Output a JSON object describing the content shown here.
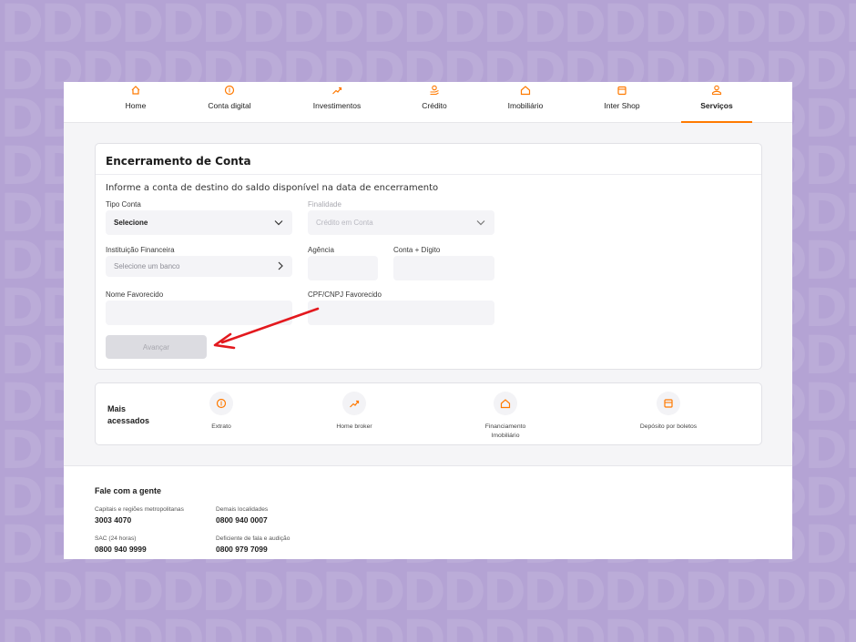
{
  "nav": [
    {
      "label": "Home",
      "icon": "home-icon"
    },
    {
      "label": "Conta digital",
      "icon": "coin-icon"
    },
    {
      "label": "Investimentos",
      "icon": "chart-up-icon"
    },
    {
      "label": "Crédito",
      "icon": "hand-coin-icon"
    },
    {
      "label": "Imobiliário",
      "icon": "house-icon"
    },
    {
      "label": "Inter Shop",
      "icon": "shop-icon"
    },
    {
      "label": "Serviços",
      "icon": "services-icon",
      "active": true
    }
  ],
  "form": {
    "title": "Encerramento de Conta",
    "subtitle": "Informe a conta de destino do saldo disponível na data de encerramento",
    "tipo_conta_label": "Tipo Conta",
    "tipo_conta_value": "Selecione",
    "finalidade_label": "Finalidade",
    "finalidade_value": "Crédito em Conta",
    "instituicao_label": "Instituição Financeira",
    "instituicao_placeholder": "Selecione um banco",
    "agencia_label": "Agência",
    "conta_label": "Conta + Dígito",
    "nome_label": "Nome Favorecido",
    "cpf_label": "CPF/CNPJ Favorecido",
    "avancar_label": "Avançar"
  },
  "mais_acessados": {
    "title_line1": "Mais",
    "title_line2": "acessados",
    "items": [
      {
        "line1": "Extrato",
        "line2": "",
        "icon": "coin-icon"
      },
      {
        "line1": "Home broker",
        "line2": "",
        "icon": "chart-up-icon"
      },
      {
        "line1": "Financiamento",
        "line2": "Imobiliário",
        "icon": "house-icon"
      },
      {
        "line1": "Depósito por boletos",
        "line2": "",
        "icon": "barcode-icon"
      }
    ]
  },
  "footer": {
    "title": "Fale com a gente",
    "contacts": [
      {
        "caption": "Capitais e regiões metropolitanas",
        "number": "3003 4070"
      },
      {
        "caption": "Demais localidades",
        "number": "0800 940 0007"
      },
      {
        "caption": "SAC (24 horas)",
        "number": "0800 940 9999"
      },
      {
        "caption": "Deficiente de fala e audição",
        "number": "0800 979 7099"
      }
    ]
  },
  "colors": {
    "accent": "#ff7a00",
    "background": "#b4a3d4",
    "annotation_arrow": "#e3191e"
  }
}
